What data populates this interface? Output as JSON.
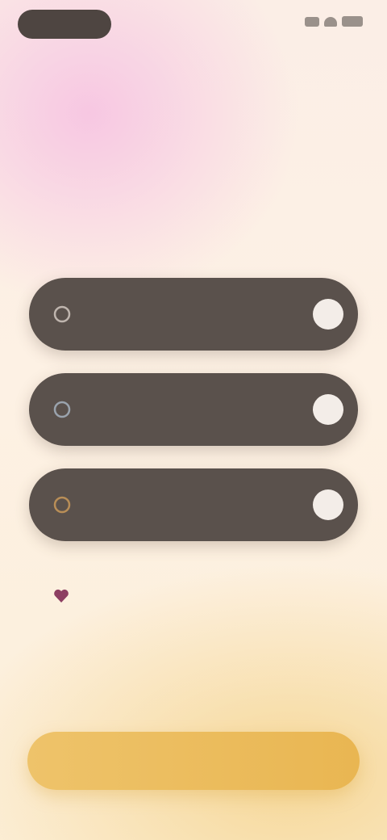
{
  "status_bar": {
    "time": "",
    "icons": [
      "cellular-signal-icon",
      "wifi-icon",
      "battery-icon"
    ]
  },
  "header": {
    "title": "",
    "subtitle": ""
  },
  "options": [
    {
      "icon": "option-icon",
      "title": "",
      "description": ""
    },
    {
      "icon": "option-icon",
      "title": "",
      "description": ""
    },
    {
      "icon": "option-icon",
      "title": "",
      "description": ""
    }
  ],
  "consent": {
    "icon": "heart-icon",
    "label": ""
  },
  "cta": {
    "label": ""
  },
  "colors": {
    "option_background": "#5a514c",
    "cta_background": "#eec36a",
    "accent_pink": "#f6c0e2",
    "headline": "#6a5d60"
  }
}
